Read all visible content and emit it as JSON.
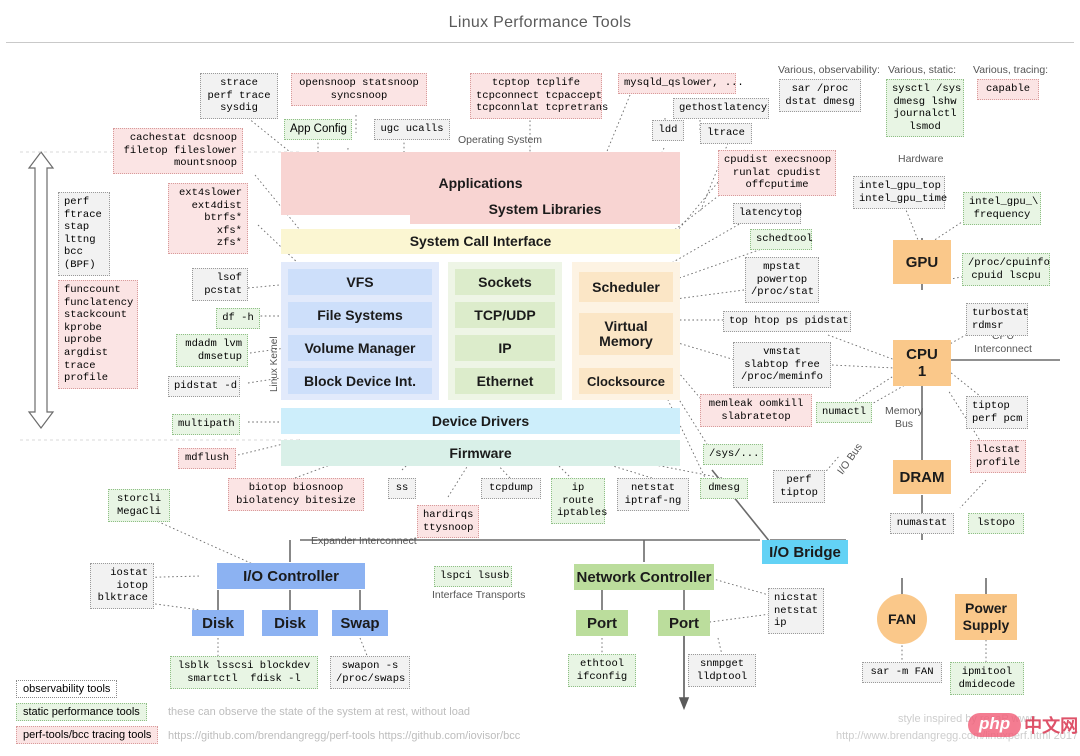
{
  "title": "Linux Performance Tools",
  "section_labels": {
    "operating_system": "Operating System",
    "hardware": "Hardware",
    "linux_kernel": "Linux Kernel",
    "various_observability": "Various, observability:",
    "various_static": "Various, static:",
    "various_tracing": "Various, tracing:",
    "cpu_interconnect": "CPU\nInterconnect",
    "memory_bus": "Memory\nBus",
    "io_bus": "I/O Bus",
    "expander_interconnect": "Expander Interconnect",
    "interface_transports": "Interface Transports"
  },
  "stack": {
    "applications": "Applications",
    "system_libraries": "System Libraries",
    "system_call_interface": "System Call Interface",
    "vfs": "VFS",
    "file_systems": "File Systems",
    "volume_manager": "Volume Manager",
    "block_device_int": "Block Device Int.",
    "sockets": "Sockets",
    "tcp_udp": "TCP/UDP",
    "ip": "IP",
    "ethernet": "Ethernet",
    "scheduler": "Scheduler",
    "virtual_memory": "Virtual\nMemory",
    "clocksource": "Clocksource",
    "device_drivers": "Device Drivers",
    "firmware": "Firmware"
  },
  "hardware": {
    "gpu": "GPU",
    "cpu": "CPU\n1",
    "dram": "DRAM",
    "io_bridge": "I/O Bridge",
    "io_controller": "I/O Controller",
    "disk1": "Disk",
    "disk2": "Disk",
    "swap": "Swap",
    "network_controller": "Network Controller",
    "port1": "Port",
    "port2": "Port",
    "fan": "FAN",
    "power_supply": "Power\nSupply"
  },
  "tools": {
    "strace": "strace\nperf trace\nsysdig",
    "opensnoop": "opensnoop statsnoop\nsyncsnoop",
    "tcptop": "tcptop tcplife\ntcpconnect tcpaccept\ntcpconnlat tcpretrans",
    "mysqld_qslower": "mysqld_qslower, ...",
    "gethostlatency": "gethostlatency",
    "ldd": "ldd",
    "ltrace": "ltrace",
    "app_config": "App Config",
    "ugc_ucalls": "ugc ucalls",
    "cachestat": "cachestat dcsnoop\nfiletop fileslower\nmountsnoop",
    "ext4slower": "ext4slower\next4dist\nbtrfs*\nxfs*\nzfs*",
    "perf_ftrace": "perf\nftrace\nstap\nlttng\nbcc\n(BPF)",
    "funccount": "funccount\nfunclatency\nstackcount\nkprobe\nuprobe\nargdist\ntrace\nprofile",
    "lsof_pcstat": "lsof\npcstat",
    "df_h": "df -h",
    "mdadm_lvm": "mdadm lvm\ndmsetup",
    "pidstat_d": "pidstat -d",
    "multipath": "multipath",
    "mdflush": "mdflush",
    "storcli": "storcli\nMegaCli",
    "iostat": "iostat\niotop\nblktrace",
    "biotop": "biotop biosnoop\nbiolatency bitesize",
    "ss": "ss",
    "hardirqs": "hardirqs\nttysnoop",
    "tcpdump": "tcpdump",
    "ip_route": "ip\nroute\niptables",
    "netstat": "netstat\niptraf-ng",
    "dmesg": "dmesg",
    "lsblk": "lsblk lsscsi blockdev\nsmartctl  fdisk -l",
    "swapon": "swapon -s\n/proc/swaps",
    "lspci": "lspci lsusb",
    "ethtool": "ethtool\nifconfig",
    "snmpget": "snmpget\nlldptool",
    "nicstat": "nicstat\nnetstat\nip",
    "sar_proc": "sar /proc\ndstat dmesg",
    "sysctl": "sysctl /sys\ndmesg lshw\njournalctl\nlsmod",
    "capable": "capable",
    "cpudist": "cpudist execsnoop\nrunlat cpudist\noffcputime",
    "latencytop": "latencytop",
    "schedtool": "schedtool",
    "mpstat": "mpstat\npowertop\n/proc/stat",
    "top_htop": "top htop ps pidstat",
    "vmstat": "vmstat\nslabtop free\n/proc/meminfo",
    "memleak": "memleak oomkill\nslabratetop",
    "sys_dots": "/sys/...",
    "dmesg2": "dmesg",
    "perf_tiptop": "perf\ntiptop",
    "numactl": "numactl",
    "intel_gpu_top": "intel_gpu_top\nintel_gpu_time",
    "intel_gpu_freq": "intel_gpu_\\\nfrequency",
    "proc_cpuinfo": "/proc/cpuinfo\ncpuid lscpu",
    "turbostat": "turbostat\nrdmsr",
    "tiptop_perf_pcm": "tiptop\nperf pcm",
    "llcstat": "llcstat\nprofile",
    "numastat": "numastat",
    "lstopo": "lstopo",
    "sar_m_fan": "sar -m FAN",
    "ipmitool": "ipmitool\ndmidecode"
  },
  "legend": {
    "observability": "observability tools",
    "static": "static performance tools",
    "tracing": "perf-tools/bcc tracing tools",
    "static_note": "these can observe the state of the system at rest, without load",
    "links": "https://github.com/brendangregg/perf-tools   https://github.com/iovisor/bcc",
    "style_credit": "style inspired by recaP www",
    "url_credit": "http://www.brendangregg.com/linuxperf.html 2017"
  },
  "watermark": {
    "php": "php",
    "cn": "中文网"
  },
  "colors": {
    "applications": "#f8d4d2",
    "syscall": "#fbf6d2",
    "kernel_blue": "#cddffa",
    "kernel_green": "#dceccb",
    "kernel_orange": "#fbe6c6",
    "device_drivers": "#cdeefb",
    "firmware": "#d9f0e8",
    "hw_orange": "#fac88a",
    "hw_cyan": "#63d2f5",
    "hw_blue": "#8cb2f2",
    "hw_green": "#bbdd9c",
    "observability_tool": "#f2f2f2",
    "static_tool": "#e8f5e4",
    "tracing_tool": "#fbe4e4"
  }
}
